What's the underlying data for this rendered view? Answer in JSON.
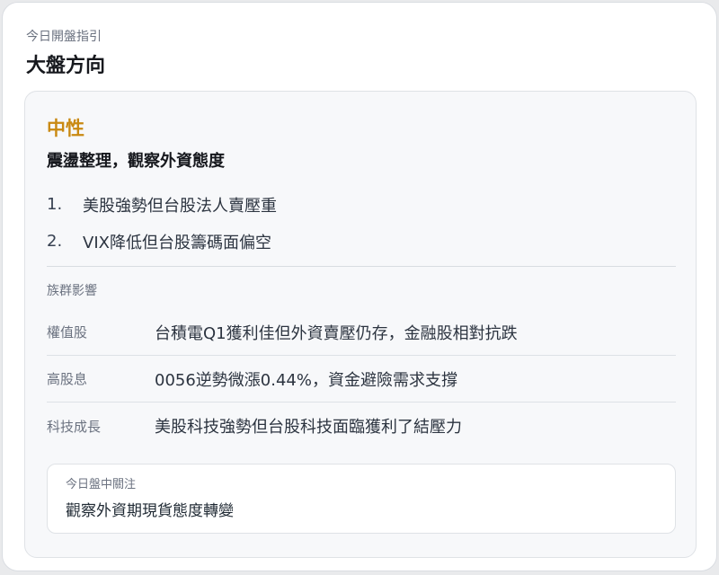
{
  "card": {
    "eyebrow": "今日開盤指引",
    "title": "大盤方向"
  },
  "direction": {
    "sentiment": "中性",
    "sentiment_color": "#c98912",
    "headline": "震盪整理，觀察外資態度"
  },
  "reasons": [
    {
      "num": "1.",
      "text": "美股強勢但台股法人賣壓重"
    },
    {
      "num": "2.",
      "text": "VIX降低但台股籌碼面偏空"
    }
  ],
  "sectors": {
    "section_label": "族群影響",
    "rows": [
      {
        "name": "權值股",
        "description": "台積電Q1獲利佳但外資賣壓仍存，金融股相對抗跌"
      },
      {
        "name": "高股息",
        "description": "0056逆勢微漲0.44%，資金避險需求支撐"
      },
      {
        "name": "科技成長",
        "description": "美股科技強勢但台股科技面臨獲利了結壓力"
      }
    ]
  },
  "watch": {
    "label": "今日盤中關注",
    "value": "觀察外資期現貨態度轉變"
  }
}
